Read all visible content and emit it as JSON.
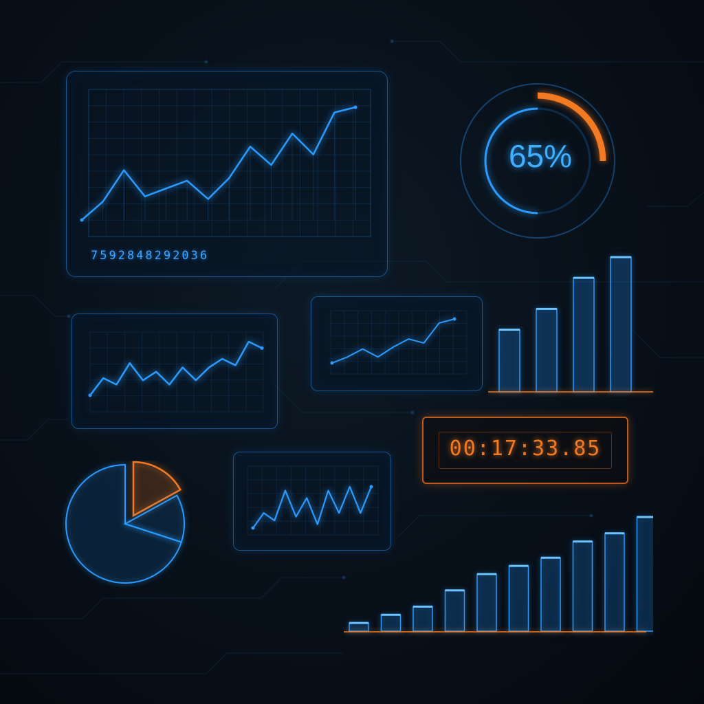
{
  "theme": {
    "accent": "#2b9bff",
    "accent_warm": "#f27a22",
    "background": "#07101a"
  },
  "main_chart": {
    "digit_strip": "7592848292036",
    "chart_data": {
      "type": "line",
      "series": [
        {
          "values": [
            5,
            12,
            24,
            14,
            17,
            20,
            13,
            21,
            33,
            26,
            38,
            30,
            46,
            48
          ]
        }
      ]
    }
  },
  "gauge": {
    "percent_label": "65%",
    "value": 0.65
  },
  "mini_chart_left": {
    "chart_data": {
      "type": "line",
      "series": [
        {
          "values": [
            5,
            13,
            10,
            20,
            12,
            16,
            10,
            18,
            12,
            18,
            22,
            19,
            30,
            27
          ]
        }
      ]
    }
  },
  "mini_chart_center": {
    "chart_data": {
      "type": "line",
      "series": [
        {
          "values": [
            2,
            5,
            9,
            5,
            10,
            14,
            12,
            22,
            24
          ]
        }
      ]
    }
  },
  "mini_chart_bottom": {
    "chart_data": {
      "type": "line",
      "series": [
        {
          "values": [
            2,
            6,
            4,
            12,
            5,
            10,
            3,
            12,
            6,
            13,
            6,
            13
          ]
        }
      ]
    }
  },
  "bar_chart_top": {
    "chart_data": {
      "type": "bar",
      "values": [
        3,
        4,
        5.5,
        6.5
      ]
    }
  },
  "timer": {
    "time_label": "00:17:33.85"
  },
  "pie_chart": {
    "chart_data": {
      "type": "pie",
      "values": [
        70,
        17,
        13
      ]
    }
  },
  "bar_chart_bottom": {
    "chart_data": {
      "type": "bar",
      "values": [
        1,
        2,
        3,
        5,
        7,
        8,
        9,
        11,
        12,
        14
      ]
    }
  }
}
